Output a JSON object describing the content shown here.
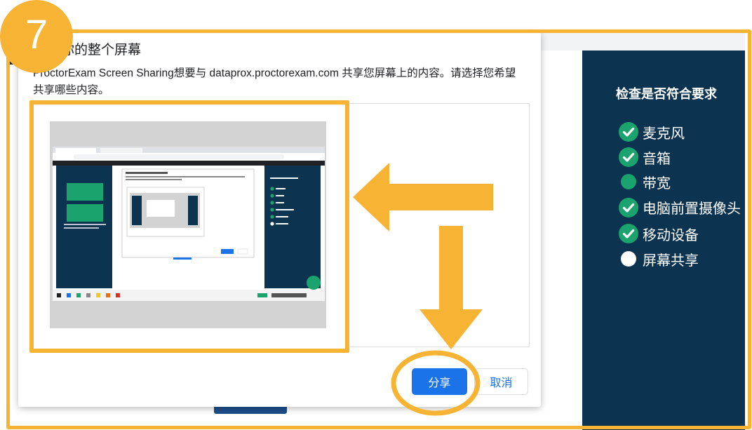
{
  "step": {
    "number": "7"
  },
  "dialog": {
    "title": "享你的整个屏幕",
    "description": "ProctorExam Screen Sharing想要与 dataprox.proctorexam.com 共享您屏幕上的内容。请选择您希望共享哪些内容。",
    "share_label": "分享",
    "cancel_label": "取消"
  },
  "checklist": {
    "title": "检查是否符合要求",
    "items": [
      {
        "label": "麦克风",
        "status": "checked",
        "icon": "check-circle-icon"
      },
      {
        "label": "音箱",
        "status": "checked",
        "icon": "check-circle-icon"
      },
      {
        "label": "带宽",
        "status": "pending-green",
        "icon": "green-dot-icon"
      },
      {
        "label": "电脑前置摄像头",
        "status": "checked",
        "icon": "check-circle-icon"
      },
      {
        "label": "移动设备",
        "status": "checked",
        "icon": "check-circle-icon"
      },
      {
        "label": "屏幕共享",
        "status": "pending",
        "icon": "white-dot-icon"
      }
    ]
  },
  "colors": {
    "highlight": "#f7b333",
    "panel_bg": "#0c3451",
    "check_green": "#1aa36d",
    "primary_blue": "#1a73e8"
  }
}
